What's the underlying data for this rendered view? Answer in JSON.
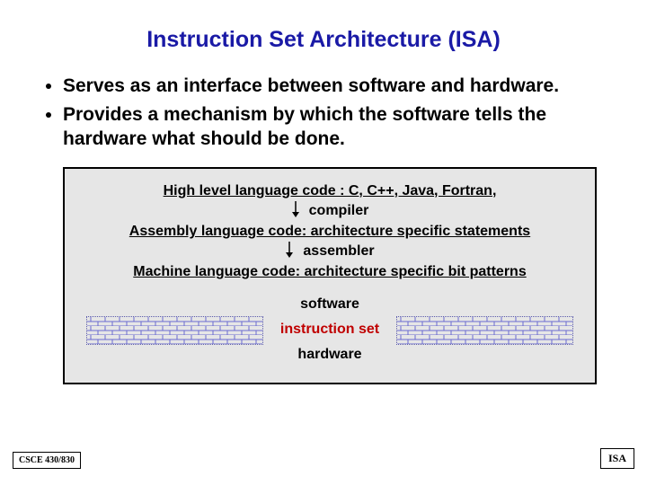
{
  "title": "Instruction Set Architecture (ISA)",
  "bullets": [
    "Serves as an interface between software and hardware.",
    "Provides a mechanism by which the software tells the hardware what should be done."
  ],
  "diagram": {
    "line1": "High level language code : C, C++, Java, Fortran,",
    "stage1": "compiler",
    "line2": "Assembly language code: architecture specific statements",
    "stage2": "assembler",
    "line3": "Machine language code: architecture specific bit patterns",
    "software": "software",
    "instruction_set": "instruction set",
    "hardware": "hardware"
  },
  "footer": {
    "left": "CSCE 430/830",
    "right": "ISA"
  }
}
